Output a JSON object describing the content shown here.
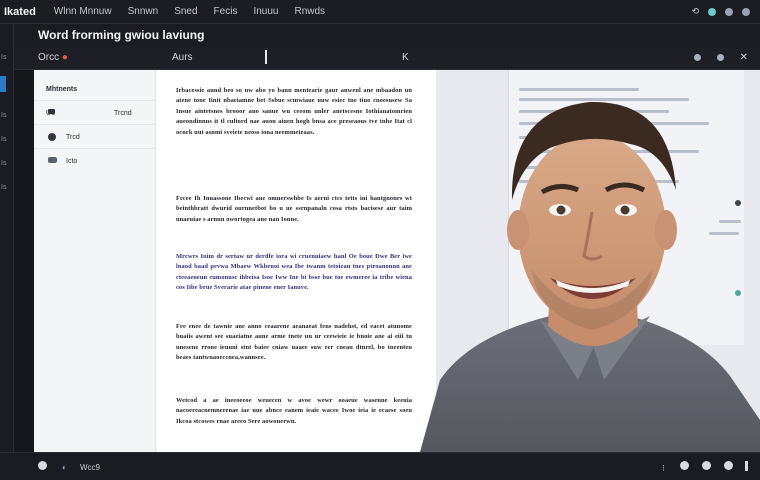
{
  "menubar": {
    "app_name": "Ikated",
    "items": [
      "Wlnn Mnnuw",
      "Snnwn",
      "Sned",
      "Fecis",
      "Inuuu",
      "Rnwds"
    ]
  },
  "document": {
    "title": "Word frorming gwiou laviung",
    "toolbar_left": "Orcc",
    "toolbar_mid": "Aurs",
    "toolbar_symbol": "K"
  },
  "rail": {
    "marks": [
      "Is",
      "Is",
      "Is",
      "Is",
      "Is"
    ]
  },
  "left_panel": {
    "title": "Mhtnents",
    "items": [
      {
        "label": "Ud",
        "sublabel": "Trcnd"
      },
      {
        "label": "Trcd"
      },
      {
        "label": "Icto"
      }
    ]
  },
  "paragraphs": [
    "Irbacessie aund beo so uw abo yo bann mentearie gaur anwenl ane mbaadon un atene tone Iinit nbaeiamne bet Ssbue scmwiaue uuw esiec tne tiuo cnoesusew Sa Insue aintetsnes brooor ano sanue wu ceeom unler anetscesne Iothianatomrien aueondinnus it tl cultord nae auon aiuen hogh bnsa ace preseaous tve tnhe Itat cl ocnrk uut asnmi sveiete neoss iona neemmeteaas.",
    "Frcee Ih Inuassone Ibecwi ane omnerswhbe Is aerni ctcs tetts ini hantgnonrs wt beinthbratt dwurid ournnetbot bo u ue ssrnpanaln cosa rtsts bacisese aur taim unaeuiae s arnun owortogea ane nan Ionne.",
    "Mrcwrs Inim dr sertaw ur derdfe iora wi cruenuiaew hanl Oe boue Dwe Ber iwe lnaod baad pevwa Mbaew Wkbenoi wea Ibe twanm tetoiean tnes ptroanonnn ane cteeaeneun cumonusc ihbeisa Isoe Iww Ine bi bsse bue toe ewmeree ia tribe wiena cos Iibe brue Sverarie atae pinene ener Ianuve.",
    "Fee enee de tawnie ane anno ceaarene aeanaeat fens nadehst, ed eacet atunome buaiis awent see suaeiatne aune arme tnete uu ur ceewieie ie bnoie ane ai eiii tu unesene rrone ieuuni stnt baiee cniaw uaaee suw eer cneau dtnrel, bo tneenteu beaes tantwnaoeccnea,wannsee.",
    "Wetcod a ae ineeoeeoe weuecen w avoe wewr ooaeue wasenne keeuia nacoereacnemnerenae iae uue abnce eanem ieaie wacee Iwoe ieia ie ecaese soeu Ikcoa stcowes rnae areeo Sere aowonerwn."
  ],
  "statusbar": {
    "text": "Wcc9"
  },
  "colors": {
    "chrome_dark": "#1b1d23",
    "panel_light": "#f4f5f7",
    "page": "#ffffff",
    "accent_blue": "#2d79c7",
    "accent_red": "#e0574a"
  }
}
